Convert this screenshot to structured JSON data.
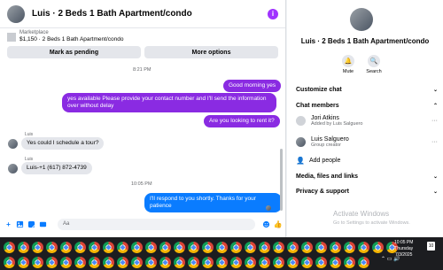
{
  "chat": {
    "title": "Luis · 2 Beds 1 Bath Apartment/condo",
    "info_icon": "i",
    "marketplace_label": "Marketplace",
    "listing": "$1,150 · 2 Beds 1 Bath Apartment/condo",
    "mark_pending": "Mark as pending",
    "more_options": "More options"
  },
  "messages": {
    "time1": "8:21 PM",
    "m1": "Good morning yes",
    "m2": "yes available Please provide your contact number and I'll send the information over without delay",
    "m3": "Are you looking to rent it?",
    "sender1": "Luis",
    "m4": "Yes could I schedule a tour?",
    "sender2": "Luis",
    "m5": "Luis-+1 (617) 872-4739",
    "time2": "10:05 PM",
    "m6": "I'll respond to you shortly. Thanks for your patience"
  },
  "composer": {
    "placeholder": "Aa",
    "add_icon": "+",
    "like_icon": "👍"
  },
  "sidebar": {
    "title": "Luis · 2 Beds 1 Bath Apartment/condo",
    "mute": "Mute",
    "search": "Search",
    "customize": "Customize chat",
    "members": "Chat members",
    "member1_name": "Jori Atkins",
    "member1_sub": "Added by Luis Salguero",
    "member2_name": "Luis Salguero",
    "member2_sub": "Group creator",
    "add_people": "Add people",
    "media": "Media, files and links",
    "privacy": "Privacy & support",
    "more": "···"
  },
  "watermark": {
    "title": "Activate Windows",
    "sub": "Go to Settings to activate Windows."
  },
  "taskbar": {
    "time": "10:05 PM",
    "day": "Thursday",
    "date": "7/3/2025",
    "notif": "10",
    "browser_icon": "chrome-icon"
  }
}
